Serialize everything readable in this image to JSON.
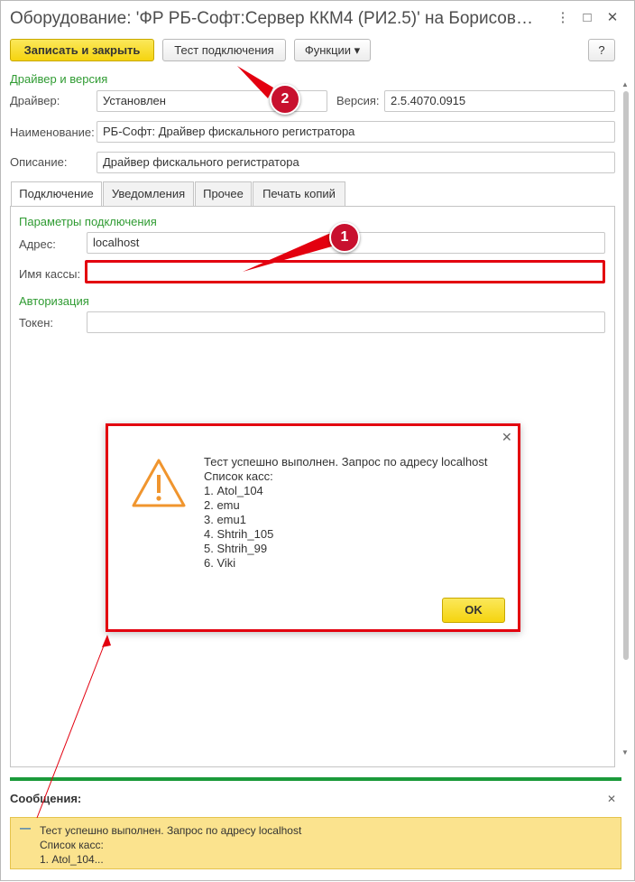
{
  "window": {
    "title": "Оборудование: 'ФР РБ-Софт:Сервер ККМ4 (РИ2.5)' на Борисов…",
    "more_icon": "⋮",
    "maximize_icon": "□",
    "close_icon": "✕"
  },
  "toolbar": {
    "save_close_label": "Записать и закрыть",
    "test_connection_label": "Тест подключения",
    "functions_label": "Функции ▾",
    "help_label": "?"
  },
  "driver_section": {
    "title": "Драйвер и версия",
    "driver_label": "Драйвер:",
    "driver_value": "Установлен",
    "version_label": "Версия:",
    "version_value": "2.5.4070.0915",
    "name_label": "Наименование:",
    "name_value": "РБ-Софт: Драйвер фискального регистратора",
    "description_label": "Описание:",
    "description_value": "Драйвер фискального регистратора"
  },
  "tabs": [
    {
      "label": "Подключение"
    },
    {
      "label": "Уведомления"
    },
    {
      "label": "Прочее"
    },
    {
      "label": "Печать копий"
    }
  ],
  "connection": {
    "params_title": "Параметры подключения",
    "address_label": "Адрес:",
    "address_value": "localhost",
    "cashbox_label": "Имя кассы:",
    "cashbox_value": "",
    "auth_title": "Авторизация",
    "token_label": "Токен:",
    "token_value": ""
  },
  "dialog": {
    "text": "Тест успешно выполнен. Запрос по адресу localhost\nСписок касс:\n1. Atol_104\n2. emu\n3. emu1\n4. Shtrih_105\n5. Shtrih_99\n6. Viki",
    "ok_label": "OK",
    "close_icon": "✕"
  },
  "messages": {
    "title": "Сообщения:",
    "close_icon": "✕",
    "collapse_icon": "—",
    "text": "Тест успешно выполнен. Запрос по адресу localhost\nСписок касс:\n1. Atol_104..."
  },
  "annotations": {
    "badge_1": "1",
    "badge_2": "2"
  },
  "colors": {
    "accent_green": "#2f9b32",
    "primary_yellow": "#f5d40f",
    "annotation_red": "#e3000f",
    "message_bg": "#fbe38e"
  }
}
